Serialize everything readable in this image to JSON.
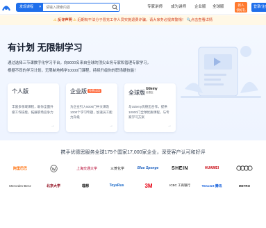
{
  "header": {
    "search": {
      "category": "发现课程",
      "placeholder": "请输入搜索内容"
    },
    "nav": [
      "专家讲师",
      "成为讲师",
      "企业版",
      "全球版"
    ],
    "promo": {
      "line1": "新人",
      "line2": "领好礼"
    },
    "register": "登录/注册"
  },
  "notice": {
    "text": "反诈声明",
    "detail": "近期有不法分子冒充工作人员实施退费诈骗，请大家务必提高警惕！",
    "link": "点击查看详情"
  },
  "hero": {
    "title": "有计划 无限制学习",
    "desc_line1": "通过选择三节课数字化学习平台，向8000名来自全球的顶尖业务专家和管理专家学习，",
    "desc_line2": "根据不同的学习计划，无限制地畅学10000门课程，持续升级你的职场硬技能！",
    "cards": [
      {
        "title": "个人版",
        "tag": "",
        "brand": "",
        "brand_sub": "",
        "text": "丰富多领域课程，助你全面升级工作技能，拓展职场竞争力"
      },
      {
        "title": "企业版",
        "tag": "免费试用",
        "brand": "",
        "brand_sub": "",
        "text": "为企业引入5000门中文课及1000个学习专题，加速员工能力升级"
      },
      {
        "title": "全球版",
        "tag": "",
        "brand": "Udemy",
        "brand_sub": "优德迈",
        "text": "与Udemy优德迈合作，提供10000门全球优质课程，与专家学习方案"
      }
    ]
  },
  "partners": {
    "title": "携手优德思服务全球175个国家17,000家企业，深受客户认可和好评",
    "row1": [
      "阿里巴巴",
      "VW",
      "上海交通大学",
      "三菱化学",
      "Blue Sponge",
      "SHEIN",
      "HUAWEI",
      "Audi"
    ],
    "row2": [
      "Mercedes-Benz",
      "北京大学",
      "理想",
      "ToysRus",
      "3M",
      "ICBC 工商银行",
      "Tencent 腾讯",
      "METRO"
    ]
  },
  "colors": {
    "brand": "#1f6feb",
    "promo": "#ff7a2f",
    "notice_bg": "#fff8e6",
    "notice_text": "#d23f1e"
  }
}
